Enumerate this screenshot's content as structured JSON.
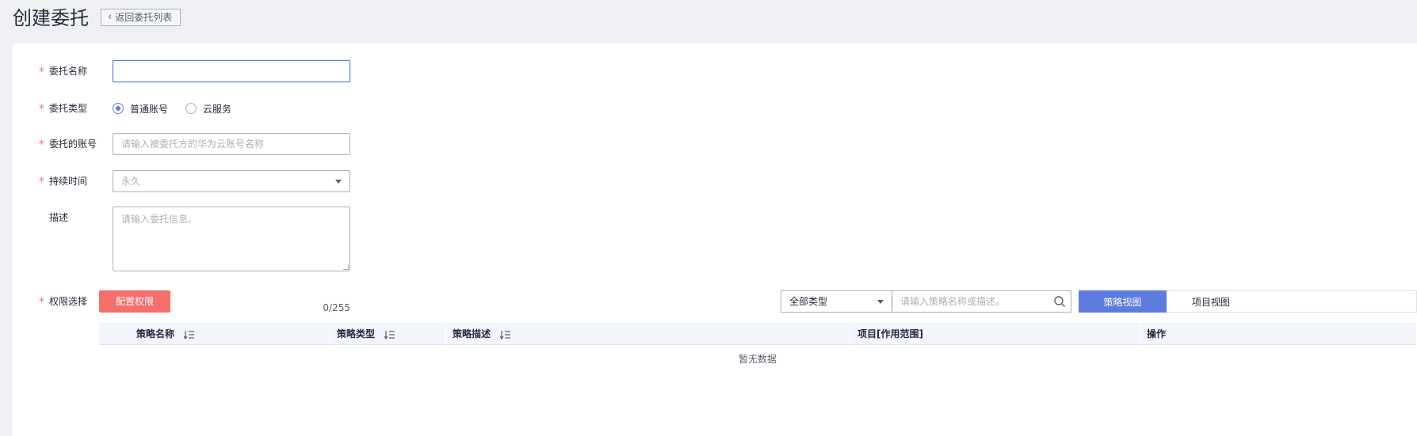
{
  "header": {
    "title": "创建委托",
    "back_label": "返回委托列表"
  },
  "form": {
    "name": {
      "label": "委托名称",
      "value": ""
    },
    "type": {
      "label": "委托类型",
      "options": [
        "普通账号",
        "云服务"
      ],
      "selected": "普通账号"
    },
    "account": {
      "label": "委托的账号",
      "placeholder": "请输入被委托方的华为云账号名称"
    },
    "duration": {
      "label": "持续时间",
      "value": "永久"
    },
    "description": {
      "label": "描述",
      "placeholder": "请输入委托信息。",
      "counter": "0/255"
    },
    "permissions": {
      "label": "权限选择",
      "config_button": "配置权限"
    }
  },
  "policy_toolbar": {
    "type_filter": "全部类型",
    "search_placeholder": "请输入策略名称或描述。",
    "view_tabs": [
      "策略视图",
      "项目视图"
    ],
    "active_view": "策略视图"
  },
  "table": {
    "columns": [
      "策略名称",
      "策略类型",
      "策略描述",
      "项目[作用范围]",
      "操作"
    ],
    "empty_text": "暂无数据"
  },
  "colors": {
    "primary": "#5e7ce0",
    "danger": "#f66f6a",
    "background": "#eff0f4"
  }
}
